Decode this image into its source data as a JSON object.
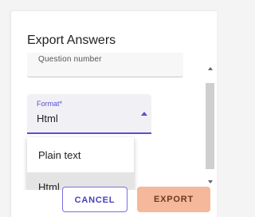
{
  "dialog": {
    "title": "Export Answers"
  },
  "previous_field": {
    "value": "Question number"
  },
  "format_field": {
    "label": "Format*",
    "value": "Html"
  },
  "format_menu": {
    "options": [
      "Plain text",
      "Html"
    ],
    "highlighted": "Html"
  },
  "actions": {
    "cancel_label": "CANCEL",
    "export_label": "EXPORT"
  },
  "colors": {
    "accent": "#5b4fcf",
    "export_button": "#f6b89a"
  },
  "icons": {
    "format_arrow": "arrow-up-icon",
    "scroll_up": "scroll-up-icon",
    "scroll_down": "scroll-down-icon"
  }
}
